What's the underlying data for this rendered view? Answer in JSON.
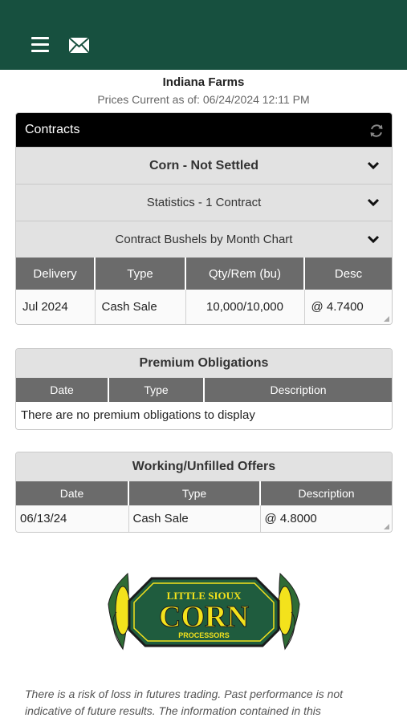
{
  "header": {
    "menu_icon": "hamburger-menu-icon",
    "mail_icon": "envelope-icon",
    "farm_name": "Indiana Farms",
    "prices_current": "Prices Current as of: 06/24/2024 12:11 PM"
  },
  "contracts": {
    "title": "Contracts",
    "commodity_row": "Corn - Not Settled",
    "statistics_row": "Statistics - 1 Contract",
    "chart_row": "Contract Bushels by Month Chart",
    "columns": [
      "Delivery",
      "Type",
      "Qty/Rem (bu)",
      "Desc"
    ],
    "rows": [
      {
        "delivery": "Jul 2024",
        "type": "Cash Sale",
        "qty": "10,000/10,000",
        "desc": "@ 4.7400"
      }
    ]
  },
  "premium": {
    "title": "Premium Obligations",
    "columns": [
      "Date",
      "Type",
      "Description"
    ],
    "empty_message": "There are no premium obligations to display"
  },
  "offers": {
    "title": "Working/Unfilled Offers",
    "columns": [
      "Date",
      "Type",
      "Description"
    ],
    "rows": [
      {
        "date": "06/13/24",
        "type": "Cash Sale",
        "desc": "@ 4.8000"
      }
    ]
  },
  "logo": {
    "line1": "LITTLE SIOUX",
    "line2": "CORN",
    "line3": "PROCESSORS",
    "colors": {
      "green": "#1f5c3e",
      "yellow": "#f3e21c",
      "dark": "#1b1b1b"
    }
  },
  "disclaimer": "There is a risk of loss in futures trading. Past performance is not indicative of future results. The information contained in this",
  "colors": {
    "topbar": "#17503f",
    "header_gray": "#6b6b6b",
    "row_gray": "#e2e2e2"
  }
}
